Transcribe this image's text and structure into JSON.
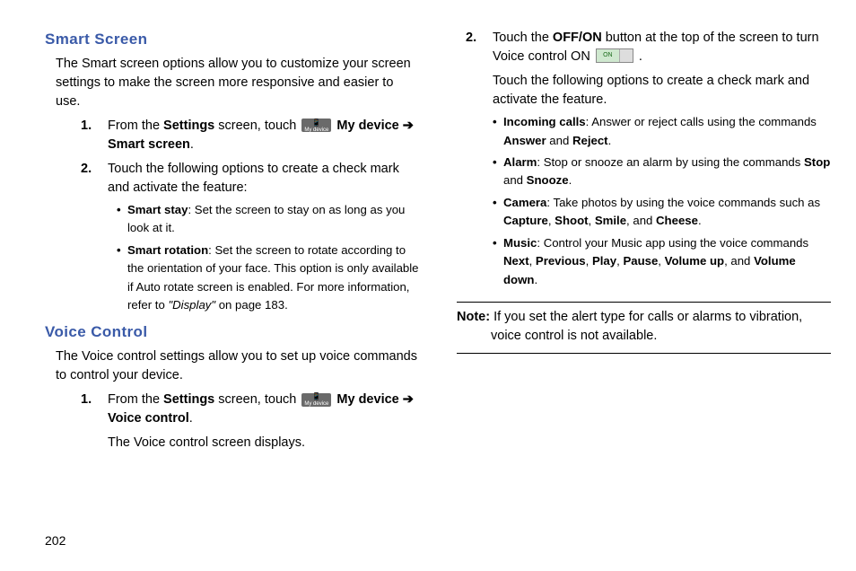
{
  "page_number": "202",
  "icons": {
    "my_device_glyph": "📱",
    "my_device_label": "My device",
    "on_label": "ON"
  },
  "left": {
    "smart_screen_heading": "Smart Screen",
    "smart_screen_intro": "The Smart screen options allow you to customize your screen settings to make the screen more responsive and easier to use.",
    "ss_step1_pre": "From the ",
    "ss_step1_settings": "Settings",
    "ss_step1_mid": " screen, touch ",
    "ss_step1_mydevice": " My device ",
    "ss_step1_arrow": "➔",
    "ss_step1_target": "Smart screen",
    "ss_step1_end": ".",
    "ss_step2": "Touch the following options to create a check mark and activate the feature:",
    "ss_b1_title": "Smart stay",
    "ss_b1_body": ": Set the screen to stay on as long as you look at it.",
    "ss_b2_title": "Smart rotation",
    "ss_b2_body_a": ": Set the screen to rotate according to the orientation of your face. This option is only available if Auto rotate screen is enabled. For more information, refer to ",
    "ss_b2_ref": "\"Display\"",
    "ss_b2_body_b": " on page 183.",
    "voice_heading": "Voice Control",
    "voice_intro": "The Voice control settings allow you to set up voice commands to control your device.",
    "vc_step1_pre": "From the ",
    "vc_step1_settings": "Settings",
    "vc_step1_mid": " screen, touch ",
    "vc_step1_mydevice": " My device ",
    "vc_step1_arrow": "➔",
    "vc_step1_target": "Voice control",
    "vc_step1_end": ".",
    "vc_step1_after": "The Voice control screen displays."
  },
  "right": {
    "r_step2_pre": "Touch the ",
    "r_step2_offon": "OFF/ON",
    "r_step2_mid": " button at the top of the screen to turn Voice control ON ",
    "r_step2_end": ".",
    "r_step2_after": "Touch the following options to create a check mark and activate the feature.",
    "b1_t": "Incoming calls",
    "b1_a": ": Answer or reject calls using the commands ",
    "b1_w1": "Answer",
    "b1_and": " and ",
    "b1_w2": "Reject",
    "b1_end": ".",
    "b2_t": "Alarm",
    "b2_a": ": Stop or snooze an alarm by using the commands ",
    "b2_w1": "Stop",
    "b2_and": " and ",
    "b2_w2": "Snooze",
    "b2_end": ".",
    "b3_t": "Camera",
    "b3_a": ": Take photos by using the voice commands such as ",
    "b3_w1": "Capture",
    "b3_c1": ", ",
    "b3_w2": "Shoot",
    "b3_c2": ", ",
    "b3_w3": "Smile",
    "b3_c3": ", and ",
    "b3_w4": "Cheese",
    "b3_end": ".",
    "b4_t": "Music",
    "b4_a": ": Control your Music app using the voice commands ",
    "b4_w1": "Next",
    "b4_c1": ", ",
    "b4_w2": "Previous",
    "b4_c2": ", ",
    "b4_w3": "Play",
    "b4_c3": ", ",
    "b4_w4": "Pause",
    "b4_c4": ", ",
    "b4_w5": "Volume up",
    "b4_c5": ", and ",
    "b4_w6": "Volume down",
    "b4_end": ".",
    "note_label": "Note:",
    "note_body": " If you set the alert type for calls or alarms to vibration, voice control is not available."
  }
}
